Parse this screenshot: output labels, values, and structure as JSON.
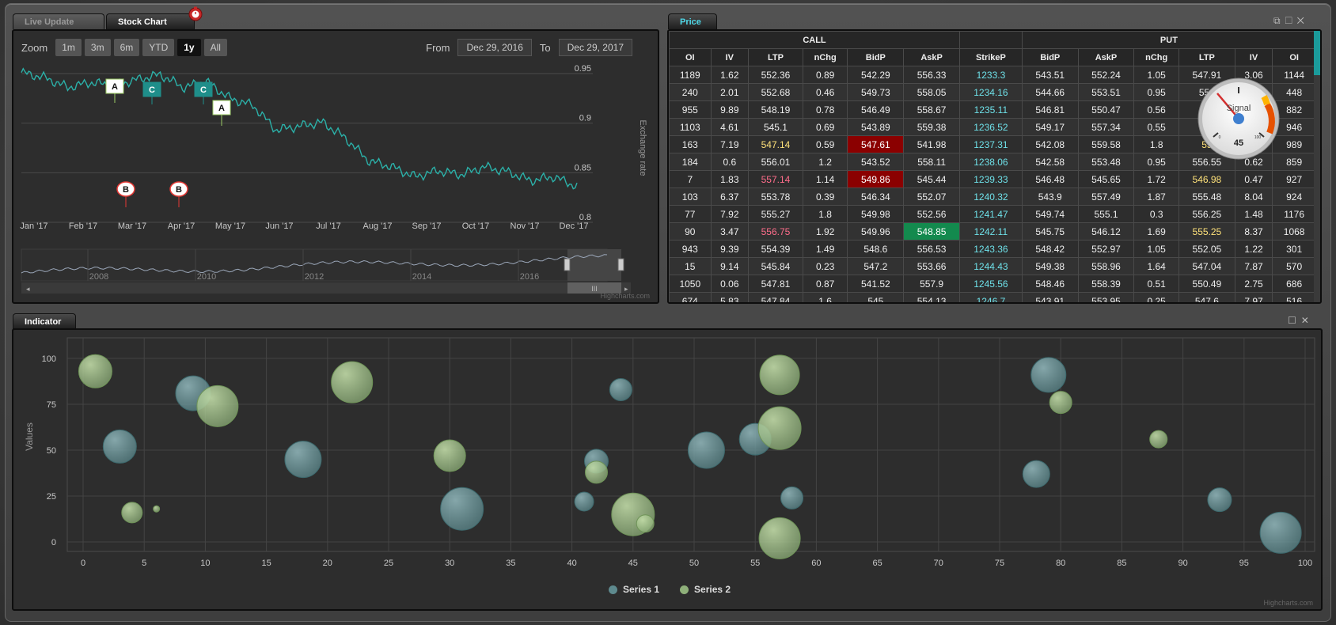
{
  "tabs": {
    "live_update": "Live Update",
    "stock_chart": "Stock Chart",
    "price": "Price",
    "indicator": "Indicator"
  },
  "stock_chart": {
    "zoom_label": "Zoom",
    "zoom_buttons": [
      "1m",
      "3m",
      "6m",
      "YTD",
      "1y",
      "All"
    ],
    "selected_zoom": "1y",
    "from_label": "From",
    "from_value": "Dec 29, 2016",
    "to_label": "To",
    "to_value": "Dec 29, 2017",
    "credit": "Highcharts.com"
  },
  "price_grid": {
    "group_call": "CALL",
    "group_put": "PUT",
    "columns": [
      "OI",
      "IV",
      "LTP",
      "nChg",
      "BidP",
      "AskP",
      "StrikeP",
      "BidP",
      "AskP",
      "nChg",
      "LTP",
      "IV",
      "OI"
    ],
    "rows": [
      [
        "1189",
        "1.62",
        "552.36",
        "0.89",
        "542.29",
        "556.33",
        "1233.3",
        "543.51",
        "552.24",
        "1.05",
        "547.91",
        "3.06",
        "1144"
      ],
      [
        "240",
        "2.01",
        "552.68",
        "0.46",
        "549.73",
        "558.05",
        "1234.16",
        "544.66",
        "553.51",
        "0.95",
        "551",
        "",
        "448"
      ],
      [
        "955",
        "9.89",
        "548.19",
        "0.78",
        "546.49",
        "558.67",
        "1235.11",
        "546.81",
        "550.47",
        "0.56",
        "",
        "",
        "882"
      ],
      [
        "1103",
        "4.61",
        "545.1",
        "0.69",
        "543.89",
        "559.38",
        "1236.52",
        "549.17",
        "557.34",
        "0.55",
        "",
        "",
        "946"
      ],
      [
        "163",
        "7.19",
        "547.14",
        "0.59",
        "547.61",
        "541.98",
        "1237.31",
        "542.08",
        "559.58",
        "1.8",
        "55",
        "",
        "989"
      ],
      [
        "184",
        "0.6",
        "556.01",
        "1.2",
        "543.52",
        "558.11",
        "1238.06",
        "542.58",
        "553.48",
        "0.95",
        "556.55",
        "0.62",
        "859"
      ],
      [
        "7",
        "1.83",
        "557.14",
        "1.14",
        "549.86",
        "545.44",
        "1239.33",
        "546.48",
        "545.65",
        "1.72",
        "546.98",
        "0.47",
        "927"
      ],
      [
        "103",
        "6.37",
        "553.78",
        "0.39",
        "546.34",
        "552.07",
        "1240.32",
        "543.9",
        "557.49",
        "1.87",
        "555.48",
        "8.04",
        "924"
      ],
      [
        "77",
        "7.92",
        "555.27",
        "1.8",
        "549.98",
        "552.56",
        "1241.47",
        "549.74",
        "555.1",
        "0.3",
        "556.25",
        "1.48",
        "1176"
      ],
      [
        "90",
        "3.47",
        "556.75",
        "1.92",
        "549.96",
        "548.85",
        "1242.11",
        "545.75",
        "546.12",
        "1.69",
        "555.25",
        "8.37",
        "1068"
      ],
      [
        "943",
        "9.39",
        "554.39",
        "1.49",
        "548.6",
        "556.53",
        "1243.36",
        "548.42",
        "552.97",
        "1.05",
        "552.05",
        "1.22",
        "301"
      ],
      [
        "15",
        "9.14",
        "545.84",
        "0.23",
        "547.2",
        "553.66",
        "1244.43",
        "549.38",
        "558.96",
        "1.64",
        "547.04",
        "7.87",
        "570"
      ],
      [
        "1050",
        "0.06",
        "547.81",
        "0.87",
        "541.52",
        "557.9",
        "1245.56",
        "548.46",
        "558.39",
        "0.51",
        "550.49",
        "2.75",
        "686"
      ],
      [
        "674",
        "5.83",
        "547.84",
        "1.6",
        "545",
        "554.13",
        "1246.7",
        "543.91",
        "553.95",
        "0.25",
        "547.6",
        "7.97",
        "516"
      ]
    ],
    "cell_styles": {
      "4-2": "hi-y",
      "4-4": "bg-red",
      "4-10": "hi-y",
      "6-2": "hi-p",
      "6-4": "bg-red",
      "6-10": "hi-y",
      "9-2": "hi-p",
      "9-5": "bg-green",
      "9-10": "hi-y"
    }
  },
  "gauge": {
    "label": "Signal",
    "value": "45",
    "min_label": "0",
    "max_label": "100"
  },
  "bubble_credit": "Highcharts.com",
  "stock_credit": "Highcharts.com",
  "chart_data": [
    {
      "type": "line",
      "title": "",
      "ylabel": "Exchange rate",
      "ylim": [
        0.8,
        0.95
      ],
      "y_ticks": [
        "0.95",
        "0.9",
        "0.85",
        "0.8"
      ],
      "x_ticks": [
        "Jan '17",
        "Feb '17",
        "Mar '17",
        "Apr '17",
        "May '17",
        "Jun '17",
        "Jul '17",
        "Aug '17",
        "Sep '17",
        "Oct '17",
        "Nov '17",
        "Dec '17"
      ],
      "series": [
        {
          "name": "",
          "x": [
            "Dec '16",
            "Jan '17",
            "Jan '17",
            "Feb '17",
            "Feb '17",
            "Mar '17",
            "Mar '17",
            "Apr '17",
            "Apr '17",
            "May '17",
            "May '17",
            "Jun '17",
            "Jun '17",
            "Jul '17",
            "Jul '17",
            "Aug '17",
            "Aug '17",
            "Sep '17",
            "Sep '17",
            "Oct '17",
            "Oct '17",
            "Nov '17",
            "Nov '17",
            "Dec '17",
            "Dec '17"
          ],
          "values": [
            0.951,
            0.946,
            0.936,
            0.941,
            0.938,
            0.944,
            0.949,
            0.936,
            0.942,
            0.925,
            0.918,
            0.893,
            0.897,
            0.901,
            0.885,
            0.862,
            0.856,
            0.846,
            0.852,
            0.848,
            0.856,
            0.851,
            0.842,
            0.846,
            0.836
          ]
        }
      ],
      "flags": [
        {
          "label": "A",
          "x": "Feb '17",
          "style": "white"
        },
        {
          "label": "C",
          "x": "Mar '17",
          "style": "teal"
        },
        {
          "label": "C",
          "x": "Apr '17",
          "style": "teal"
        },
        {
          "label": "A",
          "x": "May '17",
          "style": "white"
        },
        {
          "label": "B",
          "x": "Mar '17",
          "style": "circle"
        },
        {
          "label": "B",
          "x": "Apr '17",
          "style": "circle"
        }
      ],
      "navigator": {
        "x_ticks": [
          "2008",
          "2010",
          "2012",
          "2014",
          "2016"
        ]
      }
    },
    {
      "type": "scatter",
      "title": "",
      "ylabel": "Values",
      "xlim": [
        0,
        100
      ],
      "ylim": [
        -10,
        105
      ],
      "x_ticks": [
        0,
        5,
        10,
        15,
        20,
        25,
        30,
        35,
        40,
        45,
        50,
        55,
        60,
        65,
        70,
        75,
        80,
        85,
        90,
        95,
        100
      ],
      "y_ticks": [
        0,
        25,
        50,
        75,
        100
      ],
      "legend": "bottom-center",
      "series": [
        {
          "name": "Series 1",
          "color": "#5e8a8e",
          "points": [
            {
              "x": 9,
              "y": 81,
              "r": 22
            },
            {
              "x": 3,
              "y": 52,
              "r": 21
            },
            {
              "x": 18,
              "y": 45,
              "r": 23
            },
            {
              "x": 31,
              "y": 18,
              "r": 27
            },
            {
              "x": 41,
              "y": 22,
              "r": 12
            },
            {
              "x": 42,
              "y": 44,
              "r": 15
            },
            {
              "x": 44,
              "y": 83,
              "r": 14
            },
            {
              "x": 51,
              "y": 50,
              "r": 23
            },
            {
              "x": 55,
              "y": 56,
              "r": 20
            },
            {
              "x": 58,
              "y": 24,
              "r": 14
            },
            {
              "x": 78,
              "y": 37,
              "r": 17
            },
            {
              "x": 79,
              "y": 91,
              "r": 22
            },
            {
              "x": 93,
              "y": 23,
              "r": 15
            },
            {
              "x": 98,
              "y": 5,
              "r": 26
            }
          ]
        },
        {
          "name": "Series 2",
          "color": "#8fb07a",
          "points": [
            {
              "x": 1,
              "y": 93,
              "r": 21
            },
            {
              "x": 11,
              "y": 74,
              "r": 26
            },
            {
              "x": 22,
              "y": 87,
              "r": 26
            },
            {
              "x": 4,
              "y": 16,
              "r": 13
            },
            {
              "x": 6,
              "y": 18,
              "r": 4
            },
            {
              "x": 30,
              "y": 47,
              "r": 20
            },
            {
              "x": 42,
              "y": 38,
              "r": 14
            },
            {
              "x": 45,
              "y": 15,
              "r": 27
            },
            {
              "x": 46,
              "y": 10,
              "r": 11
            },
            {
              "x": 57,
              "y": 91,
              "r": 25
            },
            {
              "x": 57,
              "y": 62,
              "r": 27
            },
            {
              "x": 57,
              "y": 2,
              "r": 26
            },
            {
              "x": 80,
              "y": 76,
              "r": 14
            },
            {
              "x": 88,
              "y": 56,
              "r": 11
            }
          ]
        }
      ]
    }
  ]
}
